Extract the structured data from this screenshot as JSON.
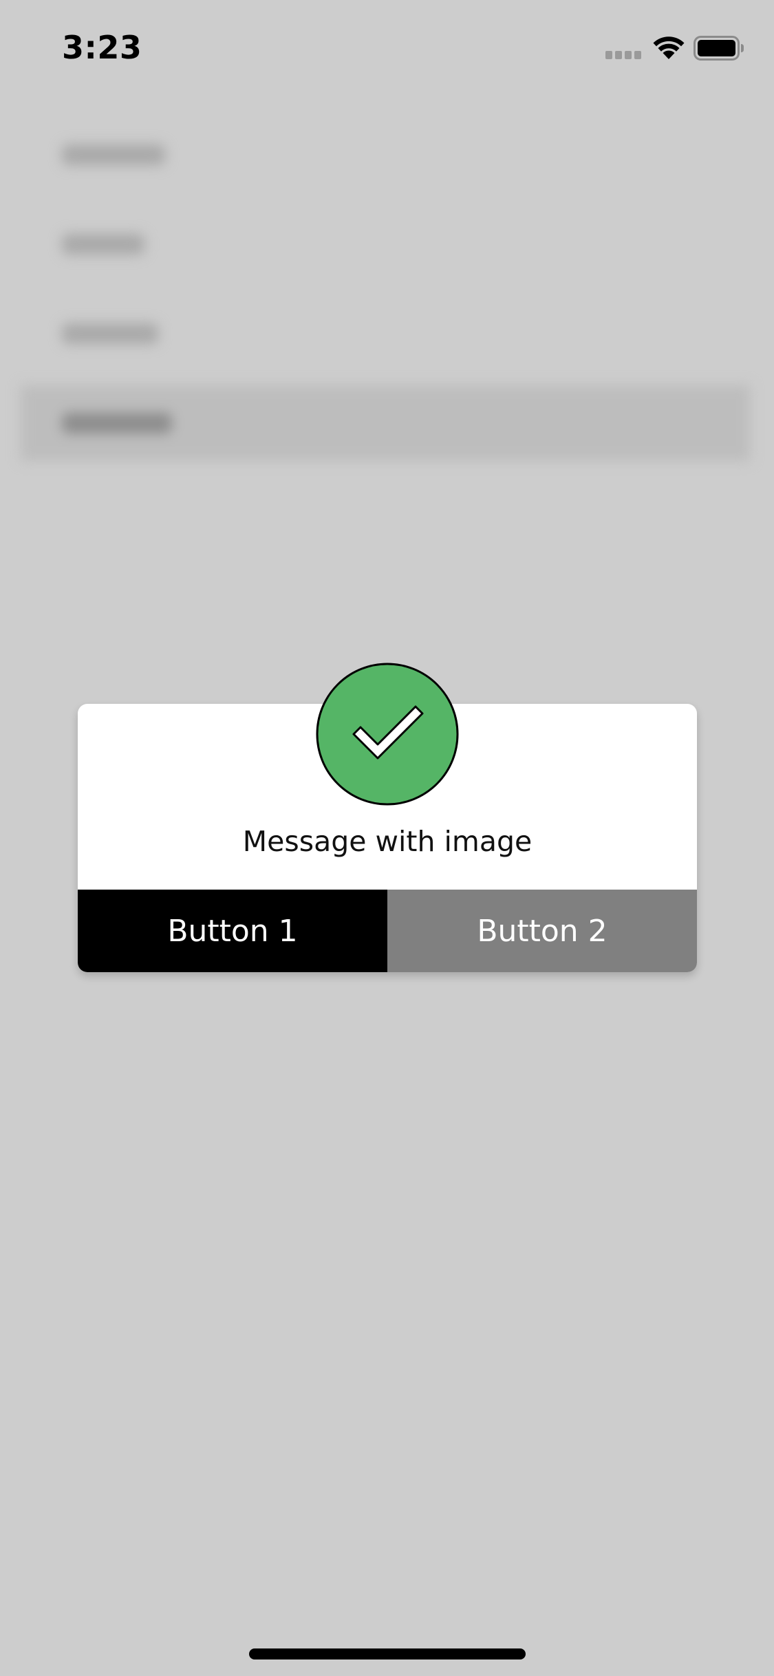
{
  "status_bar": {
    "time": "3:23"
  },
  "alert": {
    "message": "Message with image",
    "image_icon": "checkmark-circle-icon",
    "buttons": [
      {
        "label": "Button 1",
        "color": "#000000"
      },
      {
        "label": "Button 2",
        "color": "#808080"
      }
    ]
  },
  "colors": {
    "background": "#cdcdcd",
    "success_green": "#55b566"
  }
}
